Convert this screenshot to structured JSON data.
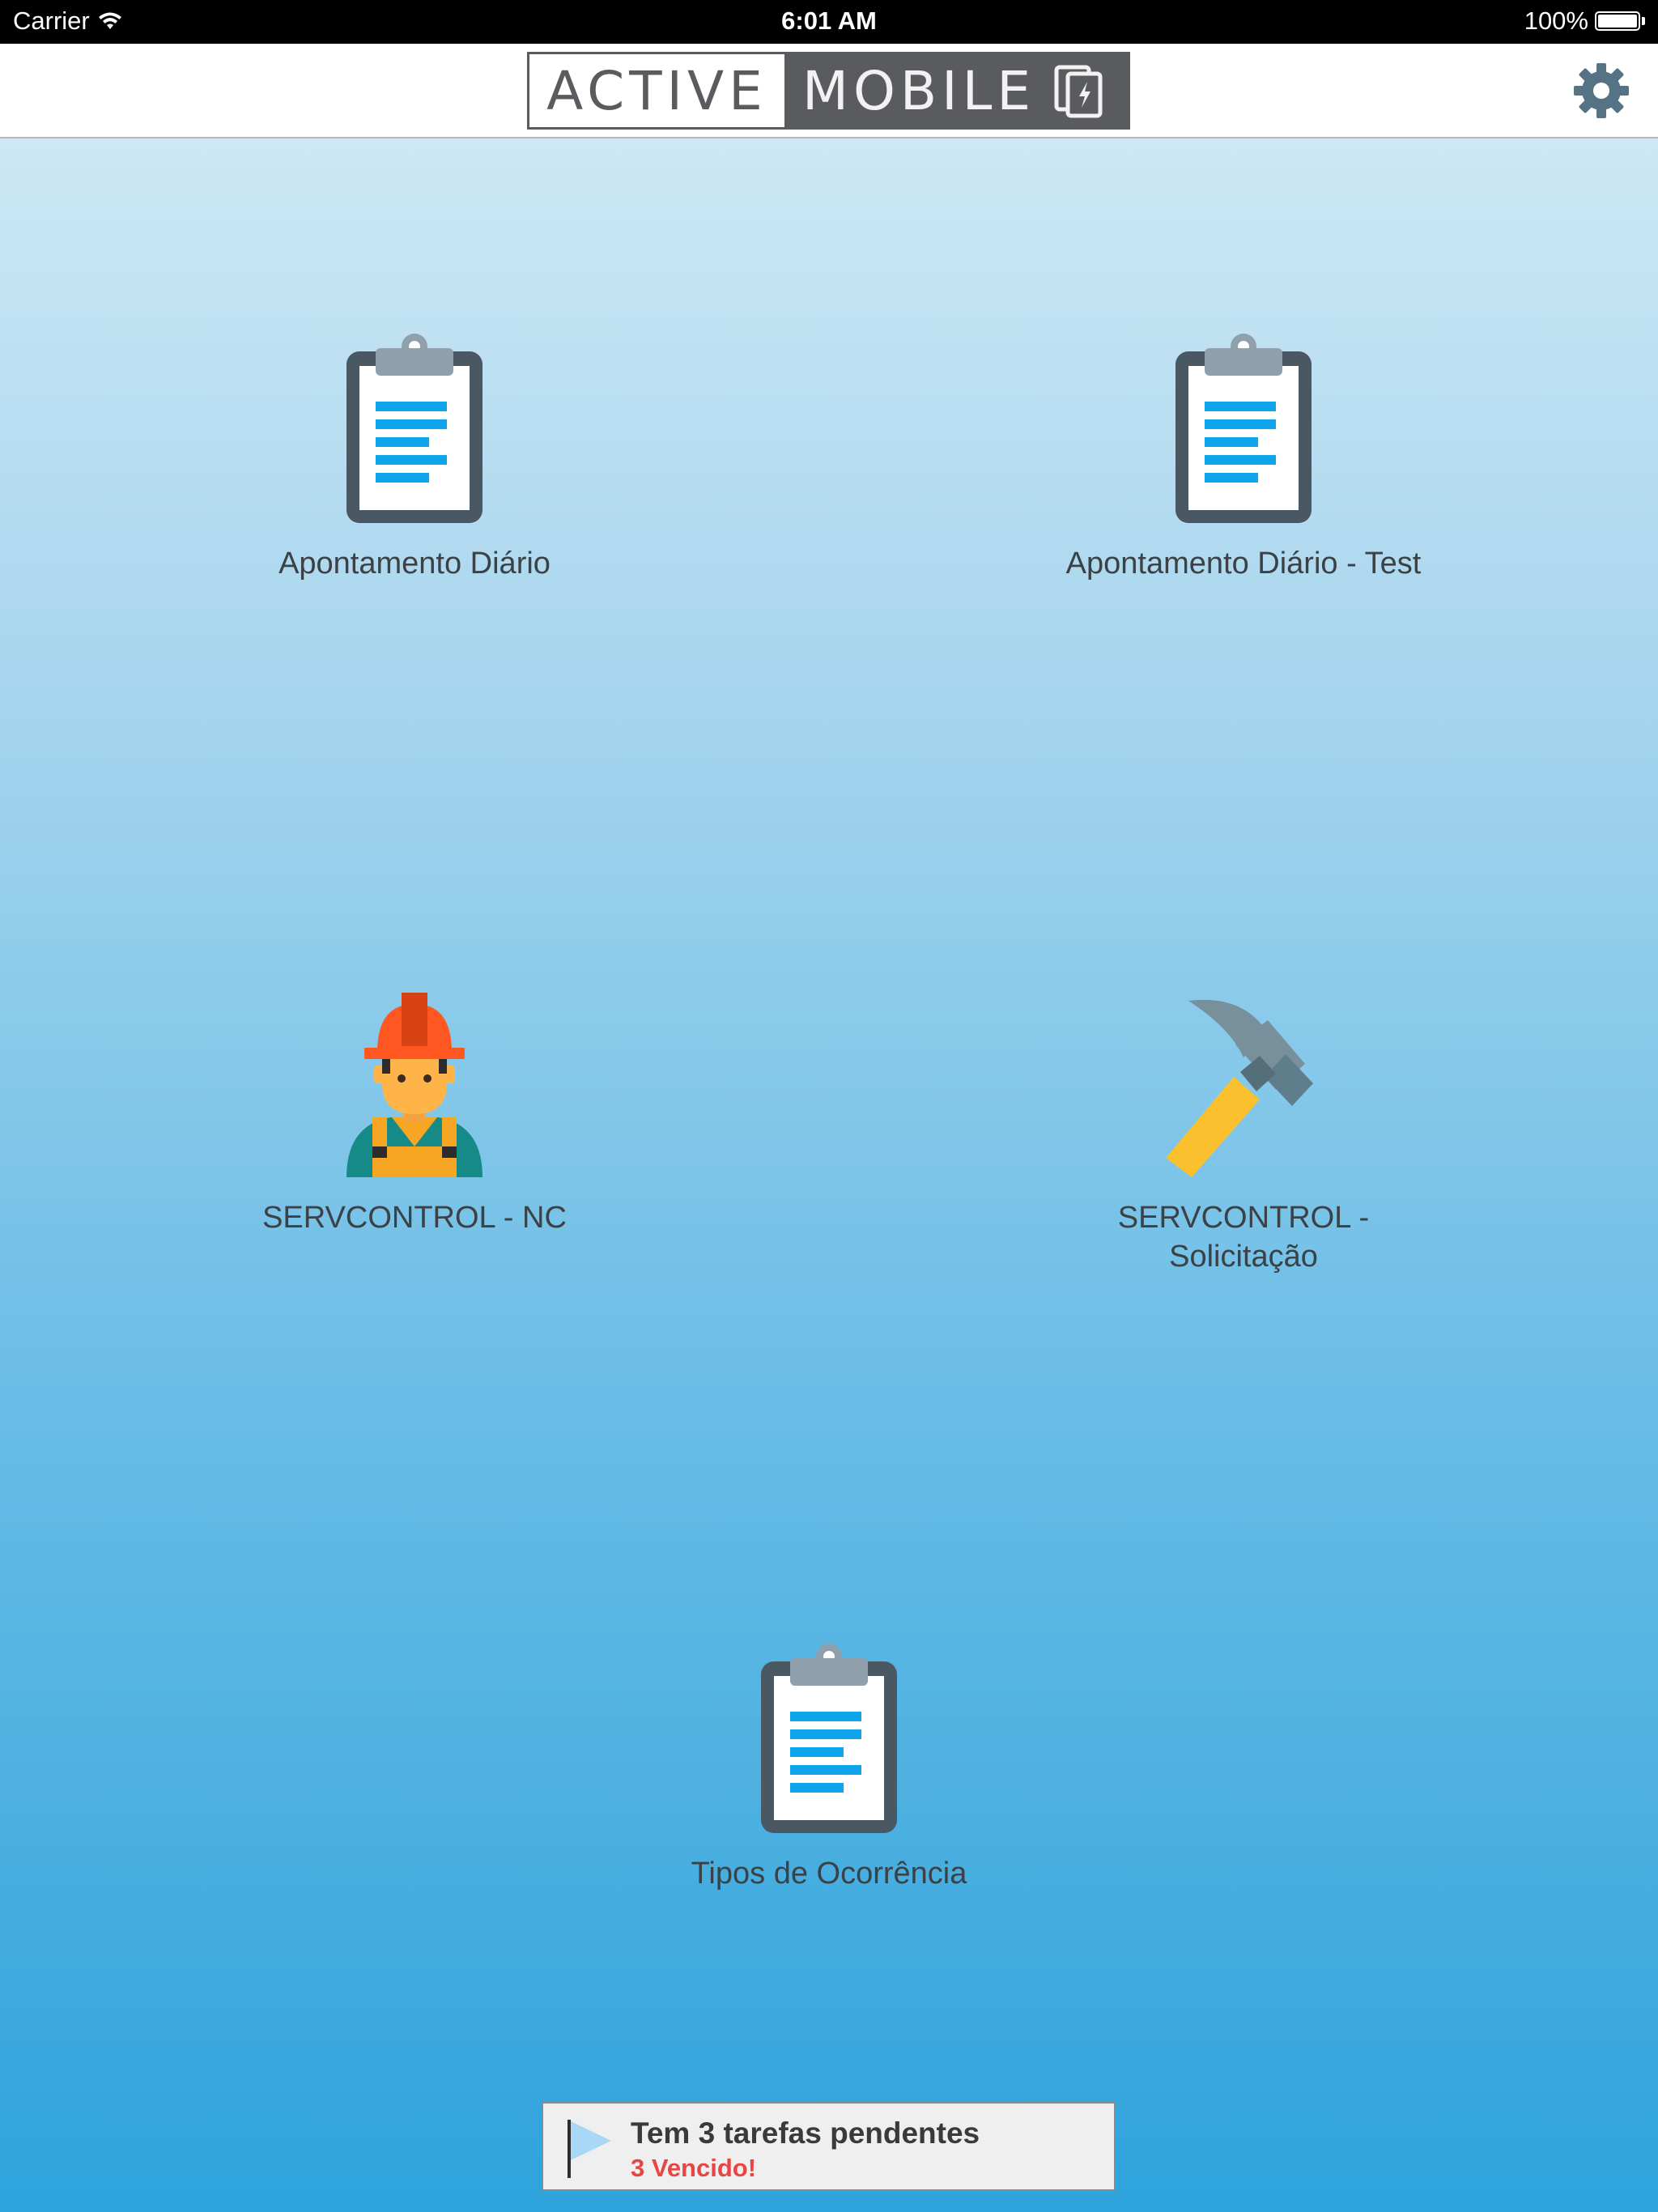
{
  "status_bar": {
    "carrier": "Carrier",
    "time": "6:01 AM",
    "battery": "100%"
  },
  "nav_bar": {
    "logo_left": "ACTIVE",
    "logo_right": "MOBILE",
    "settings_icon": "gear-icon"
  },
  "tiles": [
    {
      "label": "Apontamento Diário",
      "icon": "clipboard-icon"
    },
    {
      "label": "Apontamento Diário - Test",
      "icon": "clipboard-icon"
    },
    {
      "label": "SERVCONTROL - NC",
      "icon": "worker-icon"
    },
    {
      "label": "SERVCONTROL - Solicitação",
      "icon": "hammer-icon"
    },
    {
      "label": "Tipos de Ocorrência",
      "icon": "clipboard-icon"
    }
  ],
  "notification": {
    "title": "Tem 3 tarefas pendentes",
    "subtitle": "3 Vencido!",
    "icon": "flag-icon"
  },
  "colors": {
    "clipboard_frame": "#4a5863",
    "clipboard_lines": "#0ea5ec",
    "clipboard_clip": "#8fa0ac",
    "notification_alert": "#e84545",
    "logo_dark": "#5a5b5e"
  }
}
